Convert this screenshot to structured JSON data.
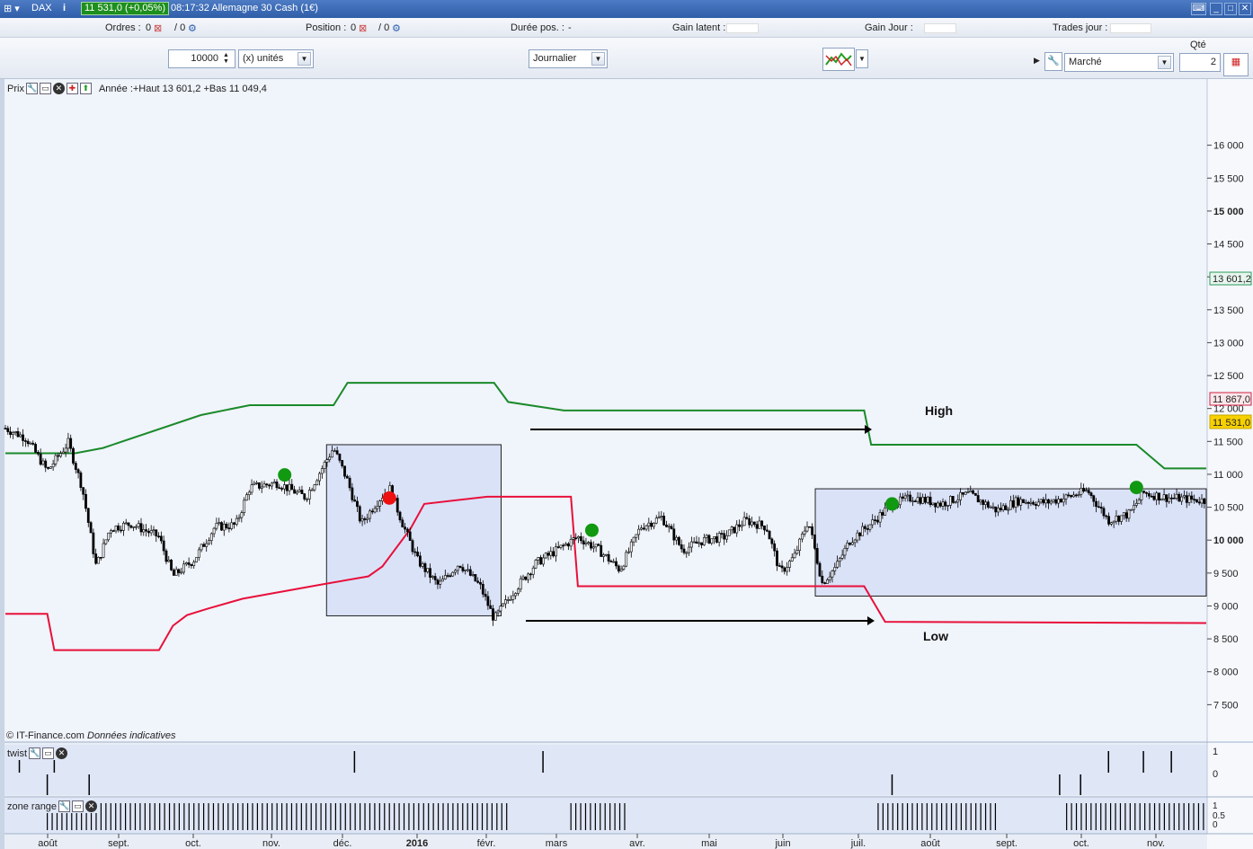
{
  "window": {
    "instrument": "DAX",
    "info_icon": "i",
    "last_price": "11 531,0 (+0,05%)",
    "time_name": "08:17:32 Allemagne 30 Cash (1€)"
  },
  "status_bar": {
    "orders_label": "Ordres :",
    "orders_value": "0",
    "orders_value2": "/ 0",
    "position_label": "Position :",
    "position_value": "0",
    "position_value2": "/ 0",
    "duration_label": "Durée pos. :",
    "duration_value": "-",
    "gain_latent_label": "Gain latent :",
    "gain_jour_label": "Gain Jour :",
    "trades_jour_label": "Trades jour :"
  },
  "toolbar": {
    "quantity_value": "10000",
    "units_select": "(x) unités",
    "period_select": "Journalier",
    "order_type_select": "Marché",
    "qte_label": "Qté",
    "qte_value": "2"
  },
  "price_panel": {
    "label": "Prix",
    "year_info": "Année :+Haut 13 601,2 +Bas 11 049,4",
    "copyright": "© IT-Finance.com",
    "disclaimer": "Données indicatives",
    "annotation_high": "High",
    "annotation_low": "Low",
    "tag_high": "13 601,2",
    "tag_red": "11 867,0",
    "tag_last": "11 531,0"
  },
  "twist_panel": {
    "label": "twist",
    "tick_top": "1",
    "tick_bottom": "0"
  },
  "zone_panel": {
    "label": "zone range",
    "tick_top": "1",
    "tick_mid": "0.5",
    "tick_bottom": "0"
  },
  "colors": {
    "high_line": "#1a8a2a",
    "low_line": "#e8103a",
    "signal_green": "#119911",
    "signal_red": "#ee1111",
    "last_price_tag": "#f7d000"
  },
  "chart_data": {
    "type": "candlestick",
    "title": "",
    "ylim": [
      7000,
      16500
    ],
    "y_ticks": [
      "16 000",
      "15 500",
      "15 000",
      "14 500",
      "14 000",
      "13 500",
      "13 000",
      "12 500",
      "12 000",
      "11 500",
      "11 000",
      "10 500",
      "10 000",
      "9 500",
      "9 000",
      "8 500",
      "8 000",
      "7 500"
    ],
    "x_ticks": [
      "août",
      "sept.",
      "oct.",
      "nov.",
      "déc.",
      "2016",
      "févr.",
      "mars",
      "avr.",
      "mai",
      "juin",
      "juil.",
      "août",
      "sept.",
      "oct.",
      "nov."
    ],
    "series": [
      {
        "values": [
          [
            0,
            11320
          ],
          [
            10,
            11320
          ],
          [
            14,
            11400
          ],
          [
            28,
            11900
          ],
          [
            35,
            12050
          ],
          [
            47,
            12050
          ],
          [
            49,
            12390
          ],
          [
            70,
            12390
          ],
          [
            72,
            12100
          ],
          [
            80,
            11970
          ],
          [
            123,
            11970
          ],
          [
            124,
            11450
          ],
          [
            162,
            11450
          ],
          [
            166,
            11090
          ],
          [
            172,
            11090
          ]
        ]
      },
      {
        "values": [
          [
            0,
            8880
          ],
          [
            6,
            8880
          ],
          [
            7,
            8330
          ],
          [
            22,
            8330
          ],
          [
            24,
            8700
          ],
          [
            26,
            8860
          ],
          [
            29,
            8960
          ],
          [
            34,
            9110
          ],
          [
            45,
            9320
          ],
          [
            52,
            9450
          ],
          [
            54,
            9600
          ],
          [
            58,
            10170
          ],
          [
            60,
            10550
          ],
          [
            69,
            10660
          ],
          [
            81,
            10660
          ],
          [
            82,
            9300
          ],
          [
            123,
            9300
          ],
          [
            126,
            8760
          ],
          [
            172,
            8740
          ]
        ]
      }
    ],
    "price_path": [
      [
        0,
        11700
      ],
      [
        3,
        11550
      ],
      [
        6,
        11050
      ],
      [
        9,
        11480
      ],
      [
        11,
        10800
      ],
      [
        13,
        9600
      ],
      [
        15,
        10180
      ],
      [
        18,
        10250
      ],
      [
        22,
        10050
      ],
      [
        24,
        9450
      ],
      [
        27,
        9700
      ],
      [
        30,
        10200
      ],
      [
        33,
        10230
      ],
      [
        35,
        10800
      ],
      [
        39,
        10870
      ],
      [
        43,
        10650
      ],
      [
        47,
        11400
      ],
      [
        49,
        10900
      ],
      [
        51,
        10250
      ],
      [
        53,
        10550
      ],
      [
        55,
        10800
      ],
      [
        57,
        10220
      ],
      [
        59,
        9700
      ],
      [
        62,
        9310
      ],
      [
        65,
        9650
      ],
      [
        68,
        9300
      ],
      [
        70,
        8800
      ],
      [
        73,
        9250
      ],
      [
        76,
        9650
      ],
      [
        79,
        9850
      ],
      [
        82,
        10050
      ],
      [
        85,
        9850
      ],
      [
        88,
        9550
      ],
      [
        91,
        10200
      ],
      [
        94,
        10350
      ],
      [
        97,
        9850
      ],
      [
        100,
        10000
      ],
      [
        103,
        10050
      ],
      [
        106,
        10300
      ],
      [
        109,
        10200
      ],
      [
        111,
        9500
      ],
      [
        113,
        9750
      ],
      [
        115,
        10300
      ],
      [
        117,
        9350
      ],
      [
        119,
        9600
      ],
      [
        121,
        10000
      ],
      [
        124,
        10250
      ],
      [
        127,
        10550
      ],
      [
        130,
        10650
      ],
      [
        134,
        10550
      ],
      [
        138,
        10700
      ],
      [
        142,
        10450
      ],
      [
        145,
        10600
      ],
      [
        149,
        10570
      ],
      [
        152,
        10650
      ],
      [
        155,
        10750
      ],
      [
        158,
        10300
      ],
      [
        161,
        10400
      ],
      [
        163,
        10720
      ],
      [
        166,
        10650
      ],
      [
        172,
        10600
      ]
    ],
    "signals": [
      {
        "x": 40,
        "y": 10990,
        "color": "green"
      },
      {
        "x": 55,
        "y": 10640,
        "color": "red"
      },
      {
        "x": 84,
        "y": 10150,
        "color": "green"
      },
      {
        "x": 127,
        "y": 10550,
        "color": "green"
      },
      {
        "x": 162,
        "y": 10800,
        "color": "green"
      }
    ],
    "ranges": [
      {
        "x0": 46,
        "x1": 71,
        "low": 8850,
        "high": 11450
      },
      {
        "x0": 116,
        "x1": 172,
        "low": 9150,
        "high": 10780
      }
    ]
  }
}
